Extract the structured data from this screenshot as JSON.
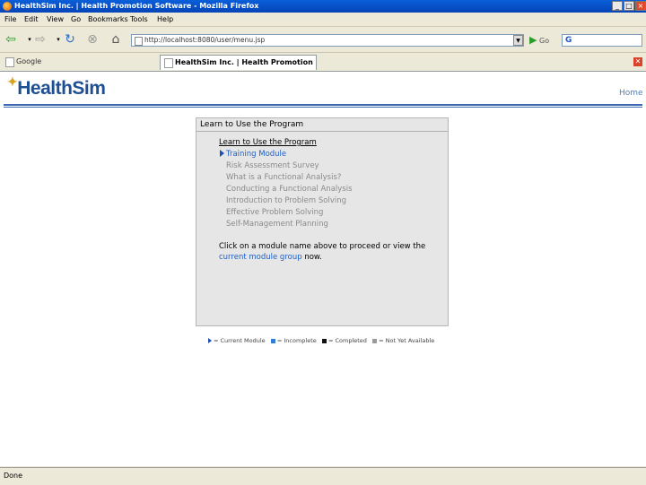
{
  "window": {
    "title": "HealthSim Inc. | Health Promotion Software - Mozilla Firefox",
    "controls": [
      "_",
      "□",
      "×"
    ]
  },
  "menu": [
    "File",
    "Edit",
    "View",
    "Go",
    "Bookmarks",
    "Tools",
    "Help"
  ],
  "nav": {
    "url": "http://localhost:8080/user/menu.jsp",
    "go_label": "Go"
  },
  "tabs": [
    {
      "label": "Google"
    },
    {
      "label": "HealthSim Inc. | Health Promotion S..."
    }
  ],
  "page": {
    "logo": "HealthSim",
    "home_link": "Home",
    "panel": {
      "header": "Learn to Use the Program",
      "group_link": "Learn to Use the Program",
      "modules": [
        "Training Module",
        "Risk Assessment Survey",
        "What is a Functional Analysis?",
        "Conducting a Functional Analysis",
        "Introduction to Problem Solving",
        "Effective Problem Solving",
        "Self-Management Planning"
      ],
      "info_prefix": "Click on a module name above to proceed or view the",
      "info_link": "current module group",
      "info_suffix": "now."
    },
    "legend": [
      {
        "label": "= Current Module",
        "color": "#1e4fb0"
      },
      {
        "label": "= Incomplete",
        "color": "#2f7fd6"
      },
      {
        "label": "= Completed",
        "color": "#111111"
      },
      {
        "label": "= Not Yet Available",
        "color": "#9a9a9a"
      }
    ]
  },
  "status": "Done"
}
